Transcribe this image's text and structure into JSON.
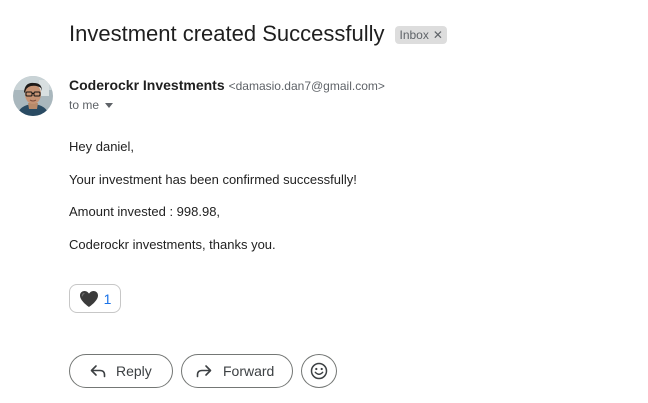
{
  "email": {
    "subject": "Investment created Successfully",
    "label": "Inbox",
    "label_remove_icon": "close-icon",
    "sender": {
      "name": "Coderockr Investments",
      "email": "<damasio.dan7@gmail.com>",
      "avatar_icon": "avatar"
    },
    "recipient_text": "to me",
    "body": {
      "greeting": "Hey daniel,",
      "line1": "Your investment has been confirmed successfully!",
      "line2": "Amount invested : 998.98,",
      "line3": "Coderockr investments, thanks you."
    }
  },
  "reaction": {
    "icon": "black-heart-icon",
    "count": "1"
  },
  "actions": {
    "reply_label": "Reply",
    "reply_icon": "reply-icon",
    "forward_label": "Forward",
    "forward_icon": "forward-icon",
    "emoji_icon": "smiley-icon"
  },
  "colors": {
    "accent": "#1a73e8",
    "label_chip": "#dddddd"
  }
}
